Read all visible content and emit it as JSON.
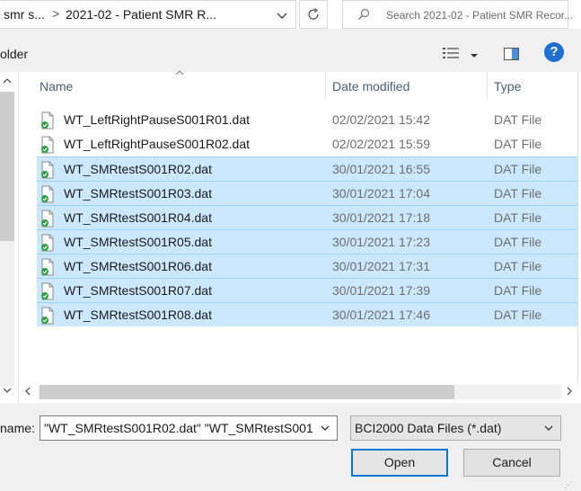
{
  "address": {
    "crumb_parent": "smr s...",
    "separator": ">",
    "crumb_current": "2021-02 - Patient SMR R..."
  },
  "search": {
    "placeholder": "Search 2021-02 - Patient SMR Recor..."
  },
  "toolbar": {
    "new_folder_label": "older"
  },
  "icons": {
    "refresh": "refresh-icon",
    "search": "search-icon",
    "view": "details-view-icon",
    "preview": "preview-pane-icon",
    "help": "help-icon",
    "file": "dat-file-icon"
  },
  "help_label": "?",
  "columns": {
    "name": "Name",
    "date": "Date modified",
    "type": "Type"
  },
  "files": [
    {
      "name": "WT_LeftRightPauseS001R01.dat",
      "date": "02/02/2021 15:42",
      "type": "DAT File",
      "selected": false
    },
    {
      "name": "WT_LeftRightPauseS001R02.dat",
      "date": "02/02/2021 15:59",
      "type": "DAT File",
      "selected": false
    },
    {
      "name": "WT_SMRtestS001R02.dat",
      "date": "30/01/2021 16:55",
      "type": "DAT File",
      "selected": true
    },
    {
      "name": "WT_SMRtestS001R03.dat",
      "date": "30/01/2021 17:04",
      "type": "DAT File",
      "selected": true
    },
    {
      "name": "WT_SMRtestS001R04.dat",
      "date": "30/01/2021 17:18",
      "type": "DAT File",
      "selected": true
    },
    {
      "name": "WT_SMRtestS001R05.dat",
      "date": "30/01/2021 17:23",
      "type": "DAT File",
      "selected": true
    },
    {
      "name": "WT_SMRtestS001R06.dat",
      "date": "30/01/2021 17:31",
      "type": "DAT File",
      "selected": true
    },
    {
      "name": "WT_SMRtestS001R07.dat",
      "date": "30/01/2021 17:39",
      "type": "DAT File",
      "selected": true
    },
    {
      "name": "WT_SMRtestS001R08.dat",
      "date": "30/01/2021 17:46",
      "type": "DAT File",
      "selected": true
    }
  ],
  "filename": {
    "label": "name:",
    "value": "\"WT_SMRtestS001R02.dat\" \"WT_SMRtestS001I"
  },
  "filetype": {
    "value": "BCI2000 Data Files (*.dat)"
  },
  "buttons": {
    "open": "Open",
    "cancel": "Cancel"
  },
  "colors": {
    "selection": "#cce8ff",
    "accent": "#0078d7",
    "help": "#1f6fd1"
  }
}
